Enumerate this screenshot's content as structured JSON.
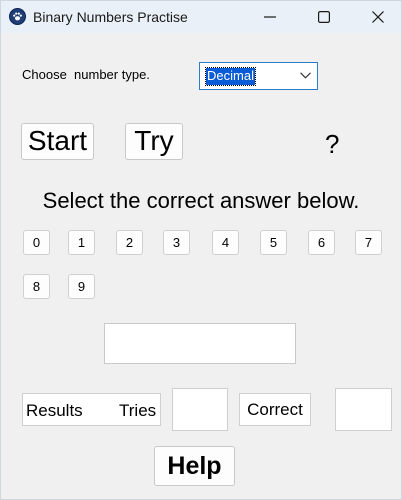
{
  "window": {
    "title": "Binary Numbers Practise",
    "controls": [
      "minimize-icon",
      "maximize-icon",
      "close-icon"
    ]
  },
  "number_type": {
    "label": "Choose  number type.",
    "selected": "Decimal"
  },
  "buttons": {
    "start": "Start",
    "try": "Try",
    "help": "Help"
  },
  "question_mark": "?",
  "instruction": "Select the correct answer below.",
  "digits": [
    "0",
    "1",
    "2",
    "3",
    "4",
    "5",
    "6",
    "7",
    "8",
    "9"
  ],
  "answer": {
    "value": ""
  },
  "results": {
    "results_label": "Results",
    "tries_label": "Tries",
    "tries_value": "",
    "correct_label": "Correct",
    "correct_value": ""
  },
  "colors": {
    "window_bg": "#f0f0f0",
    "titlebar_bg": "#eaf0f7",
    "select_border": "#2f7ad1",
    "selection_highlight": "#0a5bd6"
  }
}
